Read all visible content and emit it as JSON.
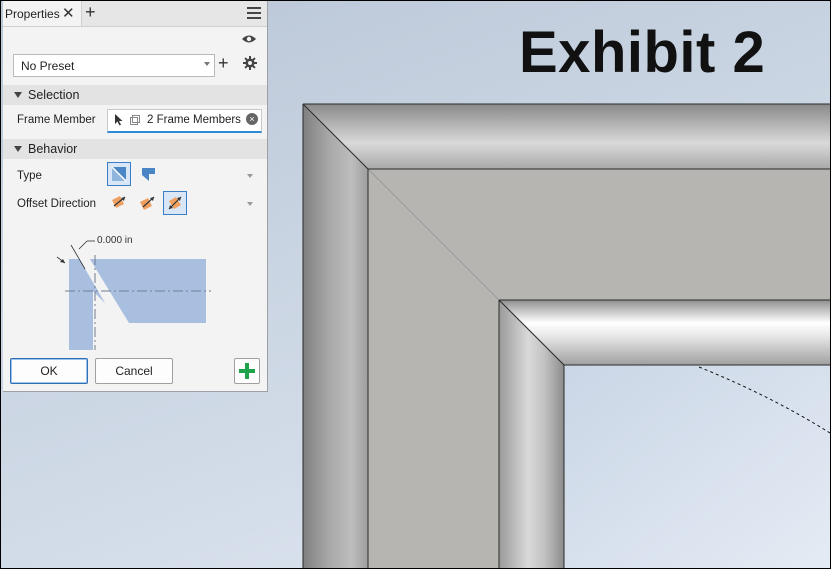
{
  "exhibit": {
    "title": "Exhibit 2"
  },
  "panel": {
    "tab_label": "Properties",
    "tab_close_glyph": "✕",
    "tab_add_glyph": "+",
    "preset": {
      "value": "No Preset",
      "add_glyph": "+"
    },
    "selection": {
      "header": "Selection",
      "frame_member_label": "Frame Member",
      "frame_member_value": "2 Frame Members"
    },
    "behavior": {
      "header": "Behavior",
      "type_label": "Type",
      "offset_label": "Offset Direction"
    },
    "diagram": {
      "dimension": "0.000 in"
    },
    "buttons": {
      "ok": "OK",
      "cancel": "Cancel"
    }
  },
  "icons": {
    "menu": "hamburger-menu-icon",
    "eye": "eye-icon",
    "gear": "gear-icon",
    "cursor": "cursor-icon",
    "frame": "frame-member-icon",
    "clear": "clear-icon",
    "apply": "green-plus-icon"
  },
  "colors": {
    "accent": "#2d8ad6",
    "diagram_fill": "#a9bfe0",
    "apply_green": "#1fa34a",
    "offset_orange": "#f0a060"
  }
}
